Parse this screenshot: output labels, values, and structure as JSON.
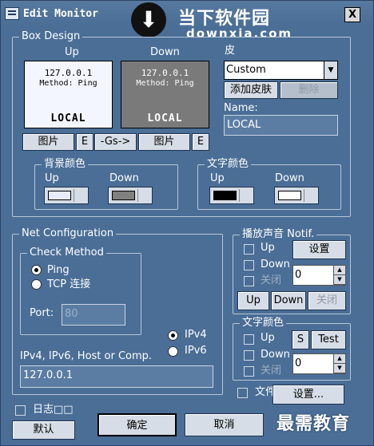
{
  "window": {
    "title": "Edit Monitor",
    "close_label": "X"
  },
  "watermark_top": {
    "cn": "当下软件园",
    "en": "downxia.com",
    "arrow": "⬇"
  },
  "watermark_bottom": "最需教育",
  "box_design": {
    "legend": "Box Design",
    "up_label": "Up",
    "down_label": "Down",
    "preview_up": {
      "ip": "127.0.0.1",
      "method": "Method: Ping",
      "host": "LOCAL",
      "bg": "#f4f6ff",
      "fg": "#000000"
    },
    "preview_down": {
      "ip": "127.0.0.1",
      "method": "Method: Ping",
      "host": "LOCAL",
      "bg": "#7a7a7a",
      "fg": "#ffffff"
    },
    "picture_label": "图片",
    "e_label": "E",
    "gs_label": "-Gs->",
    "skin_label": "皮",
    "skin_value": "Custom",
    "add_skin": "添加皮肤",
    "delete_skin": "删除",
    "name_label": "Name:",
    "name_value": "LOCAL",
    "bg_color": {
      "legend": "背景颜色",
      "up": "Up",
      "down": "Down",
      "up_color": "#e8ecff",
      "down_color": "#808080"
    },
    "text_color": {
      "legend": "文字颜色",
      "up": "Up",
      "down": "Down",
      "up_color": "#000000",
      "down_color": "#ffffff"
    }
  },
  "net_config": {
    "legend": "Net Configuration",
    "check_method": {
      "legend": "Check Method",
      "ping": "Ping",
      "tcp": "TCP 连接"
    },
    "port_label": "Port:",
    "port_value": "80",
    "ipv4": "IPv4",
    "ipv6": "IPv6",
    "host_label": "IPv4, IPv6, Host or Comp.",
    "host_value": "127.0.0.1"
  },
  "sound": {
    "legend": "播放声音 Notif.",
    "up": "Up",
    "down": "Down",
    "off": "关闭",
    "settings": "设置",
    "spin_value": "0",
    "btn_up": "Up",
    "btn_down": "Down",
    "btn_off": "关闭"
  },
  "text_color_notif": {
    "legend": "文字颜色",
    "up": "Up",
    "down": "Down",
    "off": "关闭",
    "s_label": "S",
    "test_label": "Test",
    "spin_value": "0"
  },
  "file_check": {
    "label": "文件",
    "settings": "设置..."
  },
  "log_check": {
    "label": "日志□□"
  },
  "buttons": {
    "default": "默认",
    "ok": "确定",
    "cancel": "取消"
  }
}
